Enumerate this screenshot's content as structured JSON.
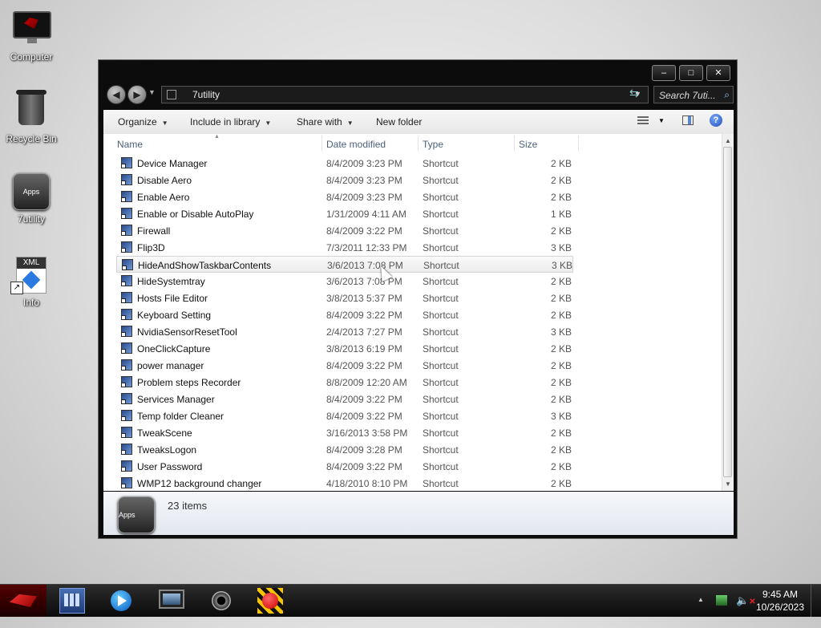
{
  "desktop": {
    "icons": [
      {
        "label": "Computer"
      },
      {
        "label": "Recycle Bin"
      },
      {
        "label": "7utility",
        "tile_text": "Apps"
      },
      {
        "label": "Info",
        "badge": "XML"
      }
    ]
  },
  "window": {
    "controls": {
      "minimize": "–",
      "maximize": "□",
      "close": "✕"
    },
    "address": {
      "path": "7utility"
    },
    "search": {
      "placeholder": "Search 7uti..."
    },
    "toolbar": {
      "organize": "Organize",
      "include_in_library": "Include in library",
      "share_with": "Share with",
      "new_folder": "New folder",
      "help": "?"
    },
    "columns": {
      "name": "Name",
      "date": "Date modified",
      "type": "Type",
      "size": "Size"
    },
    "files": [
      {
        "name": "Device Manager",
        "date": "8/4/2009 3:23 PM",
        "type": "Shortcut",
        "size": "2 KB"
      },
      {
        "name": "Disable Aero",
        "date": "8/4/2009 3:23 PM",
        "type": "Shortcut",
        "size": "2 KB"
      },
      {
        "name": "Enable Aero",
        "date": "8/4/2009 3:23 PM",
        "type": "Shortcut",
        "size": "2 KB"
      },
      {
        "name": "Enable or Disable AutoPlay",
        "date": "1/31/2009 4:11 AM",
        "type": "Shortcut",
        "size": "1 KB"
      },
      {
        "name": "Firewall",
        "date": "8/4/2009 3:22 PM",
        "type": "Shortcut",
        "size": "2 KB"
      },
      {
        "name": "Flip3D",
        "date": "7/3/2011 12:33 PM",
        "type": "Shortcut",
        "size": "3 KB"
      },
      {
        "name": "HideAndShowTaskbarContents",
        "date": "3/6/2013 7:08 PM",
        "type": "Shortcut",
        "size": "3 KB"
      },
      {
        "name": "HideSystemtray",
        "date": "3/6/2013 7:08 PM",
        "type": "Shortcut",
        "size": "2 KB"
      },
      {
        "name": "Hosts File Editor",
        "date": "3/8/2013 5:37 PM",
        "type": "Shortcut",
        "size": "2 KB"
      },
      {
        "name": "Keyboard Setting",
        "date": "8/4/2009 3:22 PM",
        "type": "Shortcut",
        "size": "2 KB"
      },
      {
        "name": "NvidiaSensorResetTool",
        "date": "2/4/2013 7:27 PM",
        "type": "Shortcut",
        "size": "3 KB"
      },
      {
        "name": "OneClickCapture",
        "date": "3/8/2013 6:19 PM",
        "type": "Shortcut",
        "size": "2 KB"
      },
      {
        "name": "power manager",
        "date": "8/4/2009 3:22 PM",
        "type": "Shortcut",
        "size": "2 KB"
      },
      {
        "name": "Problem steps Recorder",
        "date": "8/8/2009 12:20 AM",
        "type": "Shortcut",
        "size": "2 KB"
      },
      {
        "name": "Services Manager",
        "date": "8/4/2009 3:22 PM",
        "type": "Shortcut",
        "size": "2 KB"
      },
      {
        "name": "Temp folder Cleaner",
        "date": "8/4/2009 3:22 PM",
        "type": "Shortcut",
        "size": "3 KB"
      },
      {
        "name": "TweakScene",
        "date": "3/16/2013 3:58 PM",
        "type": "Shortcut",
        "size": "2 KB"
      },
      {
        "name": "TweaksLogon",
        "date": "8/4/2009 3:28 PM",
        "type": "Shortcut",
        "size": "2 KB"
      },
      {
        "name": "User Password",
        "date": "8/4/2009 3:22 PM",
        "type": "Shortcut",
        "size": "2 KB"
      },
      {
        "name": "WMP12 background changer",
        "date": "4/18/2010 8:10 PM",
        "type": "Shortcut",
        "size": "2 KB"
      }
    ],
    "hovered_index": 6,
    "details": {
      "tile_text": "Apps",
      "item_count": "23 items"
    }
  },
  "taskbar": {
    "clock": {
      "time": "9:45 AM",
      "date": "10/26/2023"
    },
    "apps": [
      "start-orb-icon",
      "explorer-icon",
      "media-player-icon",
      "monitor-icon",
      "camera-icon",
      "record-icon"
    ]
  },
  "colors": {
    "window_frame": "#0c0c0c",
    "column_header_text": "#4c607a",
    "accent": "#2a7ae2"
  }
}
